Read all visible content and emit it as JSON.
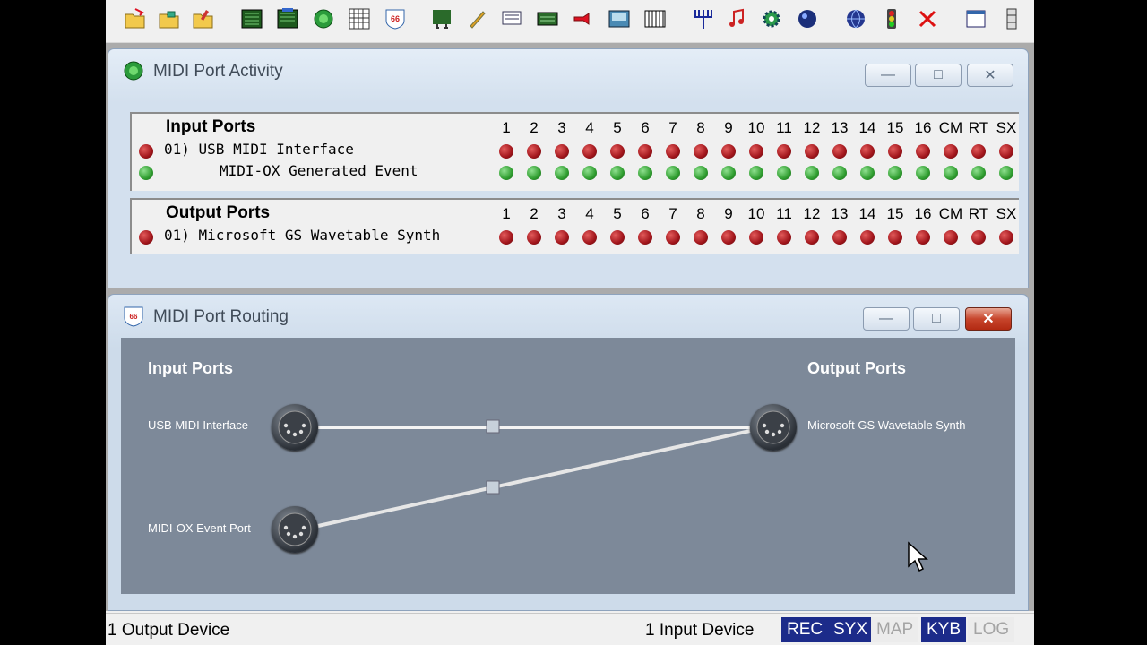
{
  "toolbar": {
    "icons": [
      "open-icon",
      "save-icon",
      "save-as-icon",
      "monitor-icon",
      "monitor-icon-2",
      "activity-icon",
      "grid-icon",
      "routing-icon",
      "mapper-icon",
      "pen-icon",
      "sysex-icon",
      "keyboard-input-icon",
      "plug-icon",
      "lcd-icon",
      "piano-icon",
      "trident-icon",
      "note-icon",
      "gear-icon",
      "circle-icon",
      "globe-icon",
      "traffic-light-icon",
      "x-icon",
      "window-icon",
      "split-icon"
    ]
  },
  "activity": {
    "title": "MIDI Port Activity",
    "input": {
      "header": "Input Ports",
      "channels": [
        "1",
        "2",
        "3",
        "4",
        "5",
        "6",
        "7",
        "8",
        "9",
        "10",
        "11",
        "12",
        "13",
        "14",
        "15",
        "16",
        "CM",
        "RT",
        "SX"
      ],
      "ports": [
        {
          "label": "01) USB MIDI Interface",
          "led": "red"
        },
        {
          "label": "MIDI-OX Generated Event",
          "led": "green"
        }
      ]
    },
    "output": {
      "header": "Output Ports",
      "channels": [
        "1",
        "2",
        "3",
        "4",
        "5",
        "6",
        "7",
        "8",
        "9",
        "10",
        "11",
        "12",
        "13",
        "14",
        "15",
        "16",
        "CM",
        "RT",
        "SX"
      ],
      "ports": [
        {
          "label": "01) Microsoft GS Wavetable Synth",
          "led": "red"
        }
      ]
    }
  },
  "routing": {
    "title": "MIDI Port Routing",
    "input_header": "Input Ports",
    "output_header": "Output Ports",
    "inputs": [
      "USB MIDI Interface",
      "MIDI-OX Event Port"
    ],
    "outputs": [
      "Microsoft GS Wavetable Synth"
    ]
  },
  "status": {
    "left": "1 Output Device",
    "middle": "1 Input Device",
    "badges": [
      {
        "label": "REC",
        "on": true
      },
      {
        "label": "SYX",
        "on": true
      },
      {
        "label": "MAP",
        "on": false
      },
      {
        "label": "KYB",
        "on": true
      },
      {
        "label": "LOG",
        "on": false
      }
    ]
  },
  "colors": {
    "led_red": "#b01c22",
    "led_green": "#35a035",
    "routing_bg": "#7d8999",
    "status_on": "#1c2b8a"
  }
}
